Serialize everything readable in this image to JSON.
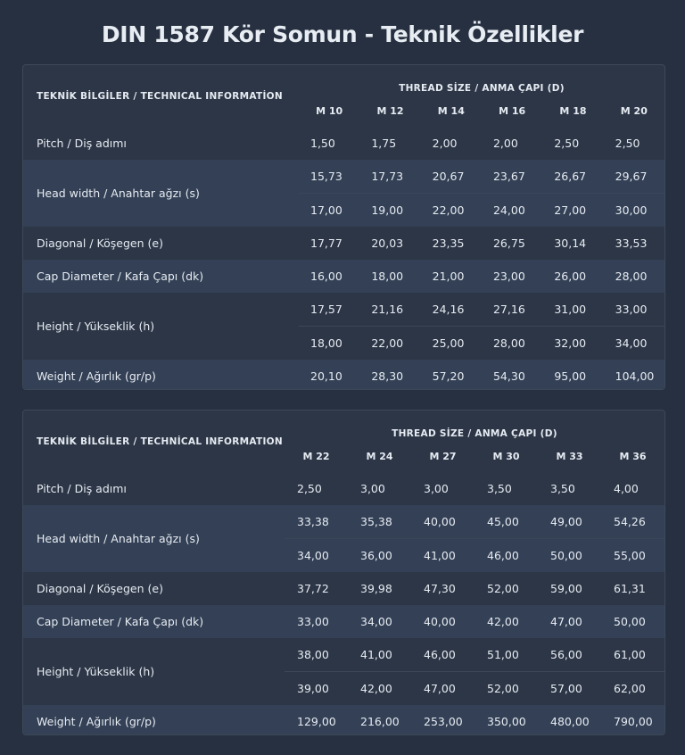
{
  "page": {
    "title": "DIN 1587 Kör Somun - Teknik Özellikler"
  },
  "tables": [
    {
      "header_label": "TEKNİK BİLGİLER / TECHNICAL INFORMATİON",
      "thread_title": "THREAD SİZE / ANMA ÇAPI (D)",
      "sizes": [
        "M 10",
        "M 12",
        "M 14",
        "M 16",
        "M 18",
        "M 20"
      ],
      "rows": [
        {
          "label": "Pitch / Diş adımı",
          "values": [
            [
              "1,50",
              "1,75",
              "2,00",
              "2,00",
              "2,50",
              "2,50"
            ]
          ]
        },
        {
          "label": "Head width / Anahtar ağzı (s)",
          "values": [
            [
              "15,73",
              "17,73",
              "20,67",
              "23,67",
              "26,67",
              "29,67"
            ],
            [
              "17,00",
              "19,00",
              "22,00",
              "24,00",
              "27,00",
              "30,00"
            ]
          ]
        },
        {
          "label": "Diagonal / Köşegen (e)",
          "values": [
            [
              "17,77",
              "20,03",
              "23,35",
              "26,75",
              "30,14",
              "33,53"
            ]
          ]
        },
        {
          "label": "Cap Diameter / Kafa Çapı (dk)",
          "values": [
            [
              "16,00",
              "18,00",
              "21,00",
              "23,00",
              "26,00",
              "28,00"
            ]
          ]
        },
        {
          "label": "Height / Yükseklik (h)",
          "values": [
            [
              "17,57",
              "21,16",
              "24,16",
              "27,16",
              "31,00",
              "33,00"
            ],
            [
              "18,00",
              "22,00",
              "25,00",
              "28,00",
              "32,00",
              "34,00"
            ]
          ]
        },
        {
          "label": "Weight / Ağırlık (gr/p)",
          "values": [
            [
              "20,10",
              "28,30",
              "57,20",
              "54,30",
              "95,00",
              "104,00"
            ]
          ]
        }
      ]
    },
    {
      "header_label": "TEKNİK BİLGİLER / TECHNİCAL INFORMATION",
      "thread_title": "THREAD SİZE / ANMA ÇAPI (D)",
      "sizes": [
        "M 22",
        "M 24",
        "M 27",
        "M 30",
        "M 33",
        "M 36"
      ],
      "rows": [
        {
          "label": "Pitch / Diş adımı",
          "values": [
            [
              "2,50",
              "3,00",
              "3,00",
              "3,50",
              "3,50",
              "4,00"
            ]
          ]
        },
        {
          "label": "Head width / Anahtar ağzı (s)",
          "values": [
            [
              "33,38",
              "35,38",
              "40,00",
              "45,00",
              "49,00",
              "54,26"
            ],
            [
              "34,00",
              "36,00",
              "41,00",
              "46,00",
              "50,00",
              "55,00"
            ]
          ]
        },
        {
          "label": "Diagonal / Köşegen (e)",
          "values": [
            [
              "37,72",
              "39,98",
              "47,30",
              "52,00",
              "59,00",
              "61,31"
            ]
          ]
        },
        {
          "label": "Cap Diameter / Kafa Çapı (dk)",
          "values": [
            [
              "33,00",
              "34,00",
              "40,00",
              "42,00",
              "47,00",
              "50,00"
            ]
          ]
        },
        {
          "label": "Height / Yükseklik (h)",
          "values": [
            [
              "38,00",
              "41,00",
              "46,00",
              "51,00",
              "56,00",
              "61,00"
            ],
            [
              "39,00",
              "42,00",
              "47,00",
              "52,00",
              "57,00",
              "62,00"
            ]
          ]
        },
        {
          "label": "Weight / Ağırlık (gr/p)",
          "values": [
            [
              "129,00",
              "216,00",
              "253,00",
              "350,00",
              "480,00",
              "790,00"
            ]
          ]
        }
      ]
    }
  ]
}
